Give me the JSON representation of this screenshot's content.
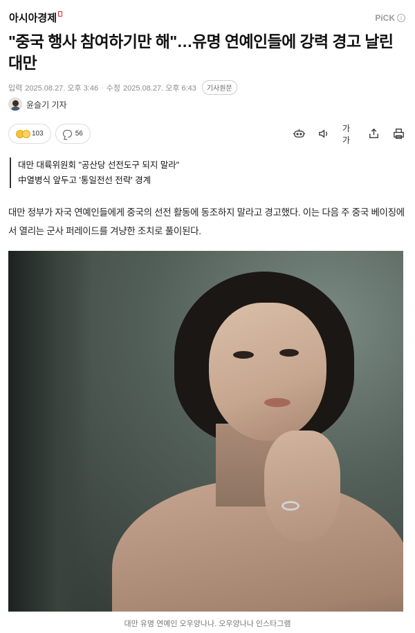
{
  "header": {
    "brand": "아시아경제",
    "pick_label": "PiCK",
    "info_icon": "i"
  },
  "article": {
    "headline": "\"중국 행사 참여하기만 해\"…유명 연예인들에 강력 경고 날린 대만",
    "meta": {
      "published_label": "입력",
      "published": "2025.08.27. 오후 3:46",
      "updated_label": "수정",
      "updated": "2025.08.27. 오후 6:43",
      "original_button": "기사원문"
    },
    "reporter": "윤슬기 기자",
    "reactions": {
      "emoji_count": "103",
      "comment_count": "56"
    },
    "tools": [
      {
        "name": "audio-bot-icon"
      },
      {
        "name": "speaker-icon"
      },
      {
        "name": "font-size-icon",
        "label": "가가"
      },
      {
        "name": "share-icon"
      },
      {
        "name": "print-icon"
      }
    ],
    "summary": [
      "대만 대륙위원회 \"공산당 선전도구 되지 말라\"",
      "中열병식 앞두고 '통일전선 전략' 경계"
    ],
    "lead": "대만 정부가 자국 연예인들에게 중국의 선전 활동에 동조하지 말라고 경고했다. 이는 다음 주 중국 베이징에서 열리는 군사 퍼레이드를 겨냥한 조치로 풀이된다.",
    "photo_caption": "대만 유명 연예인 오우양나나. 오우양나나 인스타그램"
  },
  "colors": {
    "brand_accent": "#e0202b",
    "text": "#111111",
    "meta": "#8a8a8a"
  }
}
